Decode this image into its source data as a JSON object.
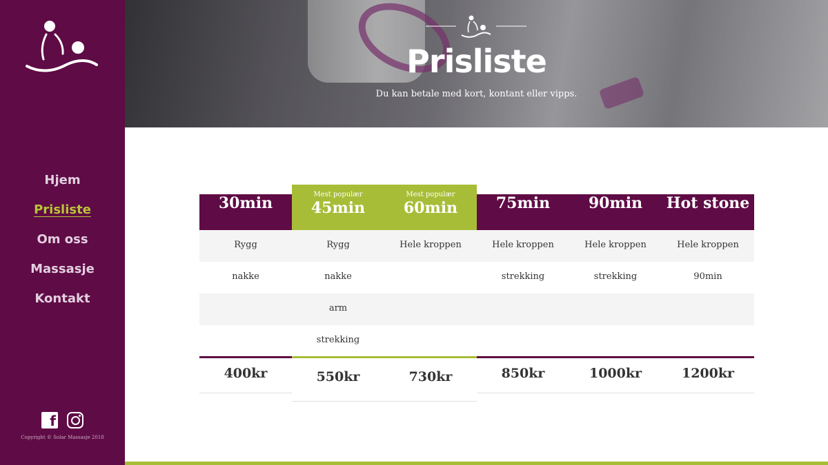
{
  "brand": {
    "name": "Solar Massasje"
  },
  "sidebar": {
    "nav": [
      {
        "label": "Hjem",
        "active": false
      },
      {
        "label": "Prisliste",
        "active": true
      },
      {
        "label": "Om oss",
        "active": false
      },
      {
        "label": "Massasje",
        "active": false
      },
      {
        "label": "Kontakt",
        "active": false
      }
    ],
    "social": [
      "facebook-icon",
      "instagram-icon"
    ],
    "copyright": "Copyright © Solar Massasje 2018"
  },
  "hero": {
    "title": "Prisliste",
    "subtitle": "Du kan betale med kort, kontant eller vipps."
  },
  "pricing": {
    "columns": [
      {
        "title": "30min",
        "badge": "",
        "featured": false,
        "items": [
          "Rygg",
          "nakke",
          "",
          ""
        ],
        "price": "400kr"
      },
      {
        "title": "45min",
        "badge": "Mest populær",
        "featured": true,
        "items": [
          "Rygg",
          "nakke",
          "arm",
          "strekking"
        ],
        "price": "550kr"
      },
      {
        "title": "60min",
        "badge": "Mest populær",
        "featured": true,
        "items": [
          "Hele kroppen",
          "",
          "",
          ""
        ],
        "price": "730kr"
      },
      {
        "title": "75min",
        "badge": "",
        "featured": false,
        "items": [
          "Hele kroppen",
          "strekking",
          "",
          ""
        ],
        "price": "850kr"
      },
      {
        "title": "90min",
        "badge": "",
        "featured": false,
        "items": [
          "Hele kroppen",
          "strekking",
          "",
          ""
        ],
        "price": "1000kr"
      },
      {
        "title": "Hot stone",
        "badge": "",
        "featured": false,
        "items": [
          "Hele kroppen",
          "90min",
          "",
          ""
        ],
        "price": "1200kr"
      }
    ]
  },
  "colors": {
    "brand_purple": "#5f0b45",
    "accent_green": "#a8bd37",
    "row_shade": "#f4f4f4"
  }
}
